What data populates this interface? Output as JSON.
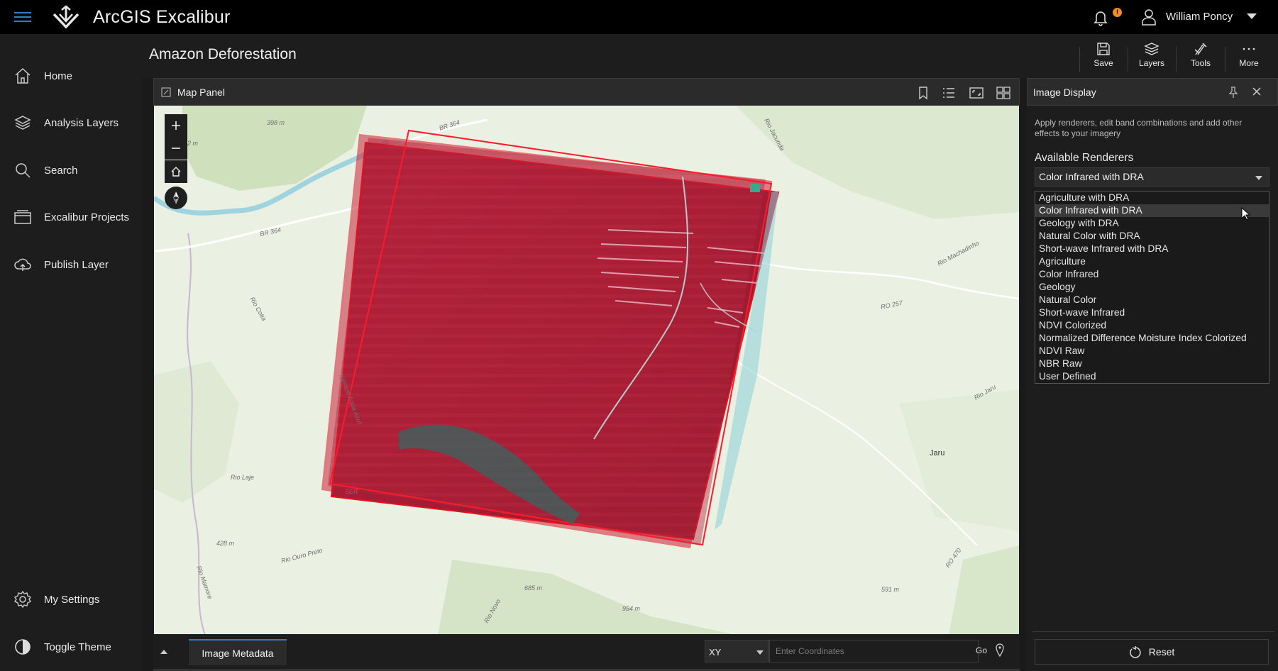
{
  "app": {
    "title": "ArcGIS Excalibur"
  },
  "header": {
    "notification_count": "!",
    "user_name": "William Poncy"
  },
  "sidebar": {
    "items": [
      {
        "label": "Home",
        "icon": "home-icon"
      },
      {
        "label": "Analysis Layers",
        "icon": "layers-icon"
      },
      {
        "label": "Search",
        "icon": "search-icon"
      },
      {
        "label": "Excalibur Projects",
        "icon": "folder-icon"
      },
      {
        "label": "Publish Layer",
        "icon": "upload-cloud-icon"
      }
    ],
    "bottom_items": [
      {
        "label": "My Settings",
        "icon": "gear-icon"
      },
      {
        "label": "Toggle Theme",
        "icon": "contrast-icon"
      }
    ]
  },
  "page": {
    "title": "Amazon Deforestation"
  },
  "toolbar": {
    "save_label": "Save",
    "layers_label": "Layers",
    "tools_label": "Tools",
    "more_label": "More"
  },
  "map_panel": {
    "title": "Map Panel",
    "labels": {
      "br364_top": "BR 364",
      "br364_left": "BR 364",
      "elev_398": "398 m",
      "elev_12": "12 m",
      "rio_jacunda": "Rio Jacunda",
      "rio_machadinho": "Rio Machadinho",
      "ro257": "RO 257",
      "rio_cotia": "Rio Cotia",
      "igarape_agua_azul": "Igarape Agua Azul",
      "rio_laje": "Rio Laje",
      "serra": "SER",
      "elev_428": "428 m",
      "rio_ouro_preto": "Rio Ouro Preto",
      "elev_685": "685 m",
      "elev_954": "954 m",
      "elev_591": "591 m",
      "jaru": "Jaru",
      "ro470": "RO 470",
      "rio_jaru": "Rio Jaru",
      "rio_mamore": "Rio Mamore",
      "rio_novo": "Rio Novo"
    }
  },
  "bottom_bar": {
    "tab_label": "Image Metadata",
    "coord_system": "XY",
    "coord_placeholder": "Enter Coordinates",
    "go_label": "Go"
  },
  "image_display": {
    "title": "Image Display",
    "description": "Apply renderers, edit band combinations and add other effects to your imagery",
    "renderers_label": "Available Renderers",
    "selected_renderer": "Color Infrared with DRA",
    "options": [
      "Agriculture with DRA",
      "Color Infrared with DRA",
      "Geology with DRA",
      "Natural Color with DRA",
      "Short-wave Infrared with DRA",
      "Agriculture",
      "Color Infrared",
      "Geology",
      "Natural Color",
      "Short-wave Infrared",
      "NDVI Colorized",
      "Normalized Difference Moisture Index Colorized",
      "NDVI Raw",
      "NBR Raw",
      "User Defined"
    ],
    "highlighted_index": 1,
    "reset_label": "Reset"
  },
  "colors": {
    "accent": "#2f7fd1",
    "badge": "#f28b22",
    "footprint": "#e8101e"
  }
}
